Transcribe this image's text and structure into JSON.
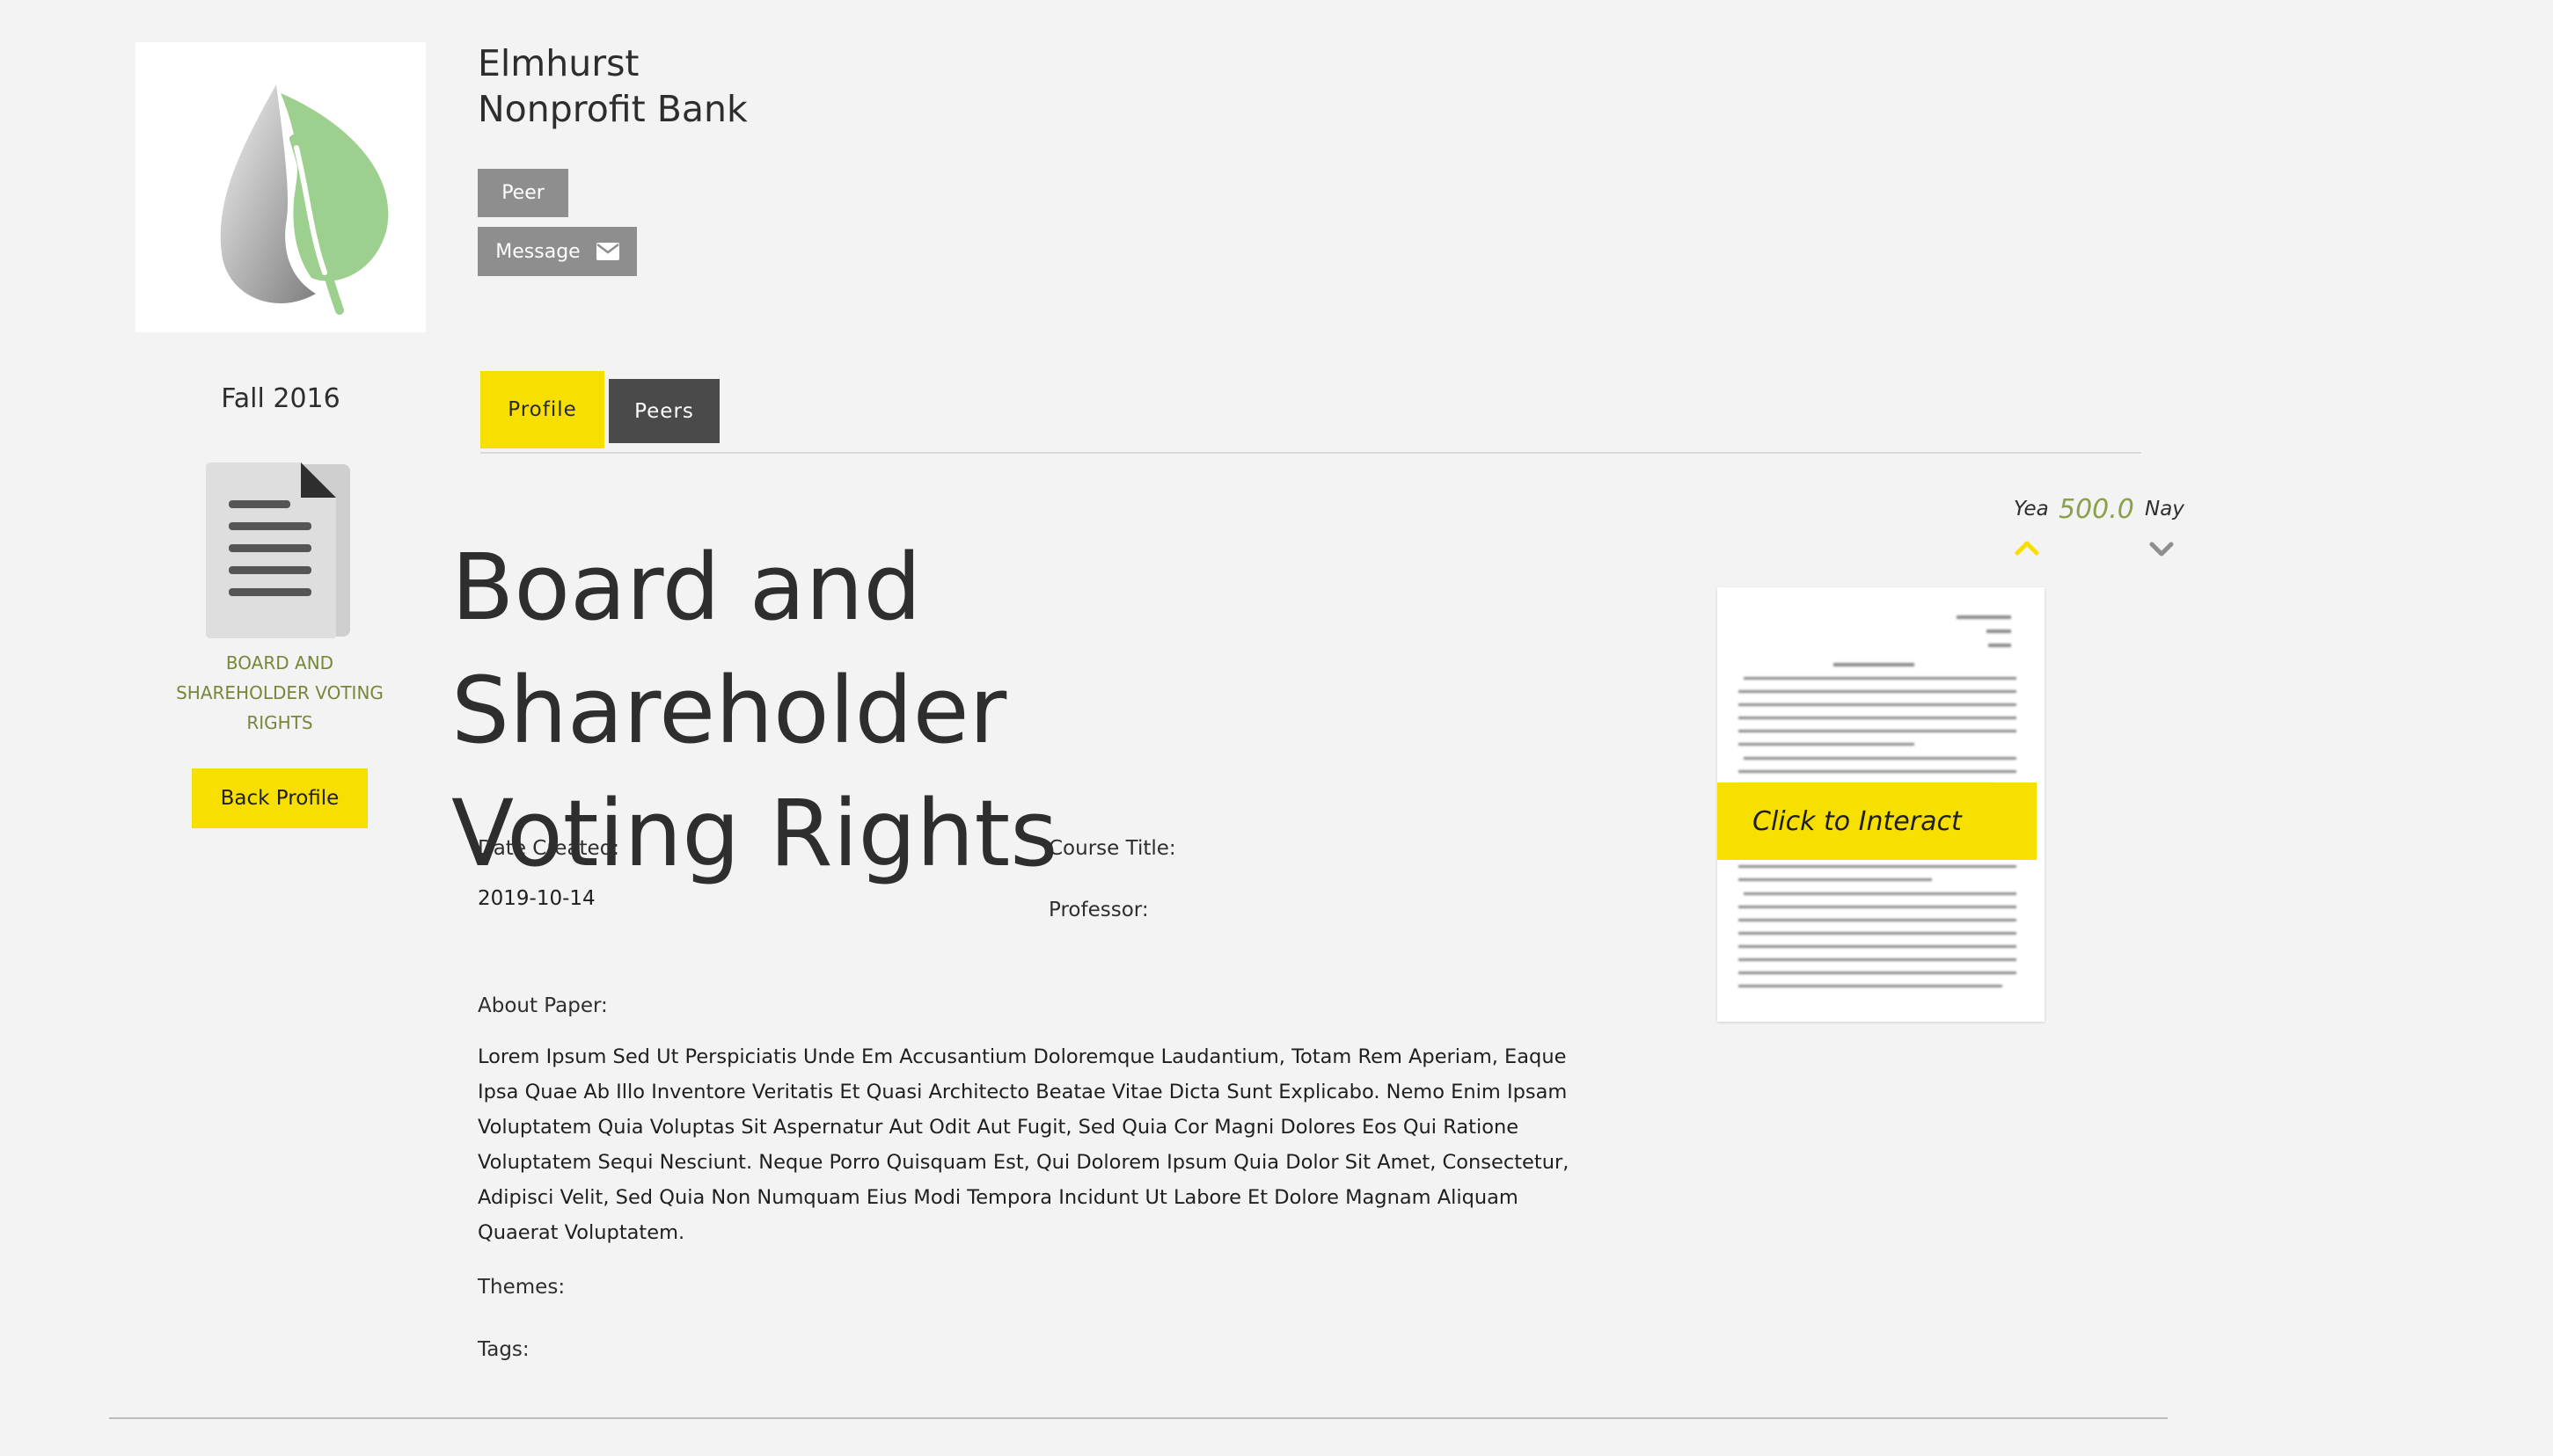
{
  "org": {
    "name_line1": "Elmhurst",
    "name_line2": "Nonprofit Bank",
    "logo_icon": "leaf-drop-logo"
  },
  "actions": {
    "peer_label": "Peer",
    "message_label": "Message",
    "message_icon": "envelope-icon"
  },
  "sidebar": {
    "semester": "Fall 2016",
    "document_icon": "document-icon",
    "document_title": "BOARD AND SHAREHOLDER VOTING RIGHTS",
    "back_label": "Back Profile"
  },
  "tabs": [
    {
      "label": "Profile",
      "active": true
    },
    {
      "label": "Peers",
      "active": false
    }
  ],
  "paper": {
    "title_line1": "Board and Shareholder",
    "title_line2": "Voting Rights",
    "date_created_label": "Date Created:",
    "date_created_value": "2019-10-14",
    "course_title_label": "Course Title:",
    "professor_label": "Professor:",
    "about_label": "About Paper:",
    "about_text": "Lorem Ipsum Sed Ut Perspiciatis Unde Em Accusantium Doloremque Laudantium, Totam Rem Aperiam, Eaque Ipsa Quae Ab Illo Inventore Veritatis Et Quasi Architecto Beatae Vitae Dicta Sunt Explicabo. Nemo Enim Ipsam Voluptatem Quia Voluptas Sit Aspernatur Aut Odit Aut Fugit, Sed Quia Cor Magni Dolores Eos Qui Ratione Voluptatem Sequi Nesciunt. Neque Porro Quisquam Est, Qui Dolorem Ipsum Quia Dolor Sit Amet, Consectetur, Adipisci Velit, Sed Quia Non Numquam Eius Modi Tempora Incidunt Ut Labore Et Dolore Magnam Aliquam Quaerat Voluptatem.",
    "themes_label": "Themes:",
    "tags_label": "Tags:"
  },
  "voting": {
    "yea_label": "Yea",
    "score": "500.0",
    "nay_label": "Nay",
    "up_icon": "chevron-up-icon",
    "down_icon": "chevron-down-icon"
  },
  "preview": {
    "interact_label": "Click to Interact"
  },
  "colors": {
    "accent_yellow": "#f7df00",
    "score_green": "#8aa04a",
    "dark_tab": "#4a4a4a",
    "gray_button": "#8e8e8e"
  }
}
